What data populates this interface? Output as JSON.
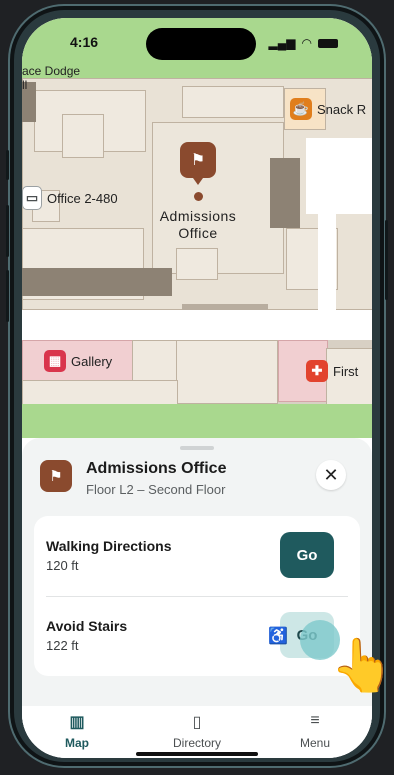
{
  "status": {
    "time": "4:16",
    "signal": "▮▮▮",
    "wifi": "wifi",
    "battery": "battery"
  },
  "map": {
    "top_label": "ace Dodge",
    "top_label2": "ll",
    "snack_label": "Snack R",
    "office_label": "Office 2-480",
    "gallery_label": "Gallery",
    "first_label": "First",
    "admissions_label_line1": "Admissions",
    "admissions_label_line2": "Office"
  },
  "sheet": {
    "title": "Admissions Office",
    "subtitle": "Floor L2 – Second Floor",
    "close_glyph": "✕",
    "routes": [
      {
        "title": "Walking Directions",
        "distance": "120 ft",
        "go_label": "Go"
      },
      {
        "title": "Avoid Stairs",
        "distance": "122 ft",
        "go_label": "Go"
      }
    ]
  },
  "nav": {
    "items": [
      {
        "label": "Map",
        "icon": "map-icon"
      },
      {
        "label": "Directory",
        "icon": "book-icon"
      },
      {
        "label": "Menu",
        "icon": "menu-icon"
      }
    ]
  },
  "colors": {
    "accent": "#1f5a5e",
    "brand": "#8a4a2e",
    "soft": "#cde7e6"
  }
}
